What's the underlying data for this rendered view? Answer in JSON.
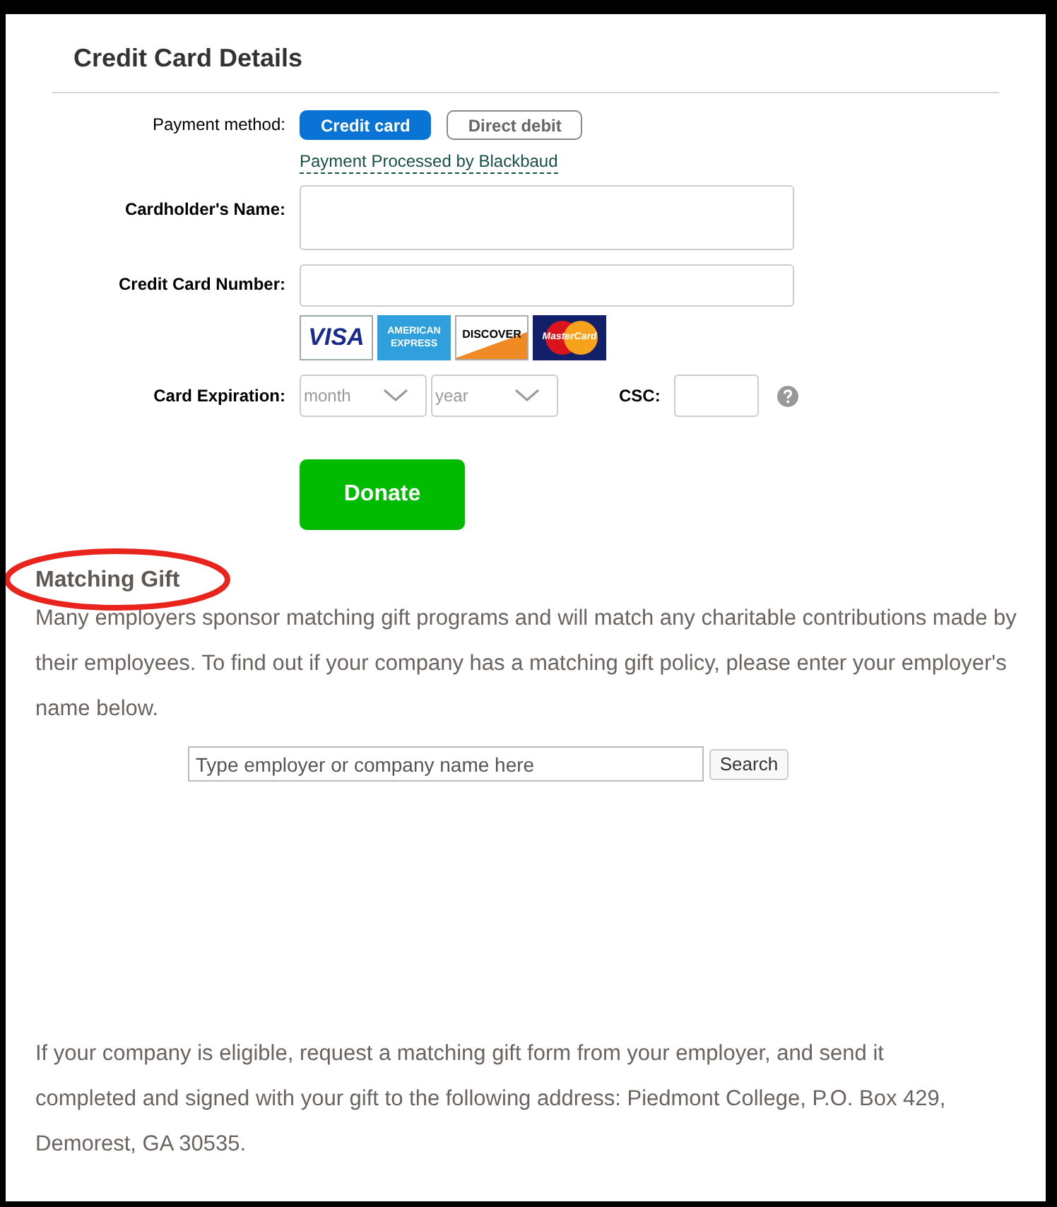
{
  "section_title": "Credit Card Details",
  "payment_method": {
    "label": "Payment method:",
    "options": [
      {
        "label": "Credit card",
        "selected": true
      },
      {
        "label": "Direct debit",
        "selected": false
      }
    ]
  },
  "processor_link": "Payment Processed by Blackbaud",
  "fields": [
    {
      "kind": "tall",
      "label": "Cardholder's Name:"
    },
    {
      "kind": "short",
      "label": "Credit Card Number:"
    }
  ],
  "card_logos": [
    {
      "kind": "visa",
      "text": "VISA"
    },
    {
      "kind": "amex",
      "text": "AMERICAN EXPRESS"
    },
    {
      "kind": "discover",
      "text": "DISCOVER"
    },
    {
      "kind": "mastercard",
      "text": "MasterCard"
    }
  ],
  "expiration": {
    "label": "Card Expiration:",
    "selects": [
      {
        "placeholder": "month"
      },
      {
        "placeholder": "year"
      }
    ]
  },
  "csc": {
    "label": "CSC:"
  },
  "donate_button": "Donate",
  "matching_gift": {
    "title": "Matching Gift",
    "intro": "Many employers sponsor matching gift programs and will match any charitable contributions made by their employees. To find out if your company has a matching gift policy, please enter your employer's name below.",
    "search": {
      "placeholder": "Type employer or company name here",
      "button": "Search"
    },
    "footer": "If your company is eligible, request a matching gift form from your employer, and send it completed and signed with your gift to the following address: Piedmont College, P.O. Box 429, Demorest, GA 30535."
  }
}
